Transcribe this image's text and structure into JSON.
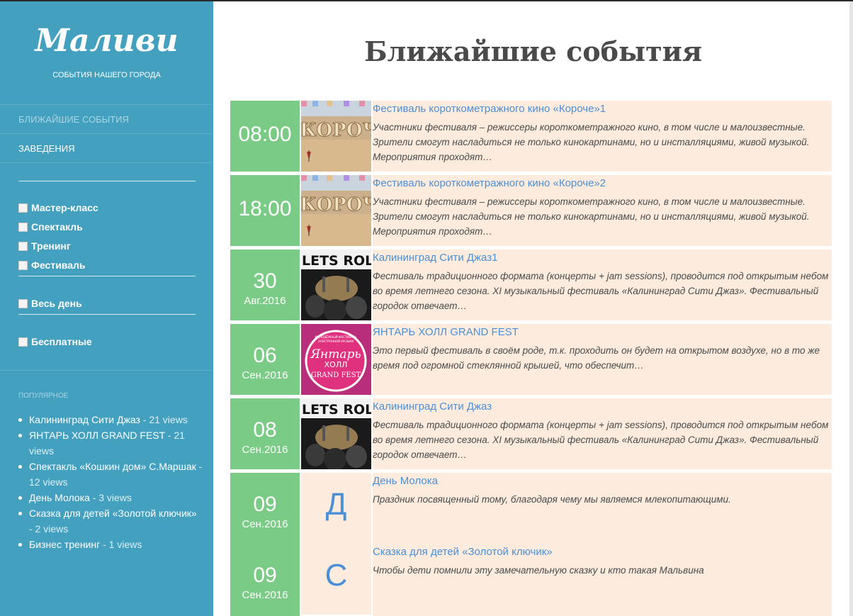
{
  "site": {
    "title": "Маливи",
    "tagline": "СОБЫТИЯ НАШЕГО ГОРОДА"
  },
  "nav": {
    "upcoming": "БЛИЖАЙШИЕ СОБЫТИЯ",
    "venues": "ЗАВЕДЕНИЯ"
  },
  "filters": {
    "categories": [
      "Мастер-класс",
      "Спектакль",
      "Тренинг",
      "Фестиваль"
    ],
    "all_day": "Весь день",
    "free": "Бесплатные"
  },
  "popular": {
    "heading": "ПОПУЛЯРНОЕ",
    "items": [
      {
        "title": "Калининград Сити Джаз",
        "views": " - 21 views"
      },
      {
        "title": "ЯНТАРЬ ХОЛЛ GRAND FEST",
        "views": " - 21 views"
      },
      {
        "title": "Спектакль «Кошкин дом» С.Маршак",
        "views": " - 12 views"
      },
      {
        "title": "День Молока",
        "views": " - 3 views"
      },
      {
        "title": "Сказка для детей «Золотой ключик»",
        "views": " - 2 views"
      },
      {
        "title": "Бизнес тренинг",
        "views": " - 1 views"
      }
    ]
  },
  "main": {
    "page_title": "Ближайшие события",
    "events": [
      {
        "time": "08:00",
        "title": "Фестиваль короткометражного кино «Короче»1",
        "desc": "Участники фестиваля – режиссеры короткометражного кино, в том числе и малоизвестные. Зрители смогут насладиться не только кинокартинами, но и инсталляциями, живой музыкой. Мероприятия проходят…"
      },
      {
        "time": "18:00",
        "title": "Фестиваль короткометражного кино «Короче»2",
        "desc": "Участники фестиваля – режиссеры короткометражного кино, в том числе и малоизвестные. Зрители смогут насладиться не только кинокартинами, но и инсталляциями, живой музыкой. Мероприятия проходят…"
      },
      {
        "day": "30",
        "month": "Авг.2016",
        "title": "Калининград Сити Джаз1",
        "desc": "Фестиваль традиционного формата (концерты + jam sessions), проводится под открытым небом во время летнего сезона. XI музыкальный фестиваль «Калининград Сити Джаз». Фестивальный городок отвечает…"
      },
      {
        "day": "06",
        "month": "Сен.2016",
        "title": "ЯНТАРЬ ХОЛЛ GRAND FEST",
        "desc": "Это первый фестиваль в своём роде, т.к. проходить он будет на открытом воздухе, но в то же время под огромной стеклянной крышей, что обеспечит…"
      },
      {
        "day": "08",
        "month": "Сен.2016",
        "title": "Калининград Сити Джаз",
        "desc": "Фестиваль традиционного формата (концерты + jam sessions), проводится под открытым небом во время летнего сезона. XI музыкальный фестиваль «Калининград Сити Джаз». Фестивальный городок отвечает…"
      },
      {
        "day": "09",
        "month": "Сен.2016",
        "letter": "Д",
        "title": "День Молока",
        "desc": "Праздник посвященный тому, благодаря чему мы являемся млекопитающими."
      },
      {
        "day": "09",
        "month": "Сен.2016",
        "letter": "С",
        "title": "Сказка для детей «Золотой ключик»",
        "desc": "Чтобы дети помнили эту замечательную сказку и кто такая Мальвина"
      }
    ]
  },
  "images": {
    "kino_lettering": "КОРОЧ",
    "jazz_lettering": "LETS ROL",
    "yantar_logo": [
      "МОЛОДЁЖНЫЙ ФЕСТИВАЛЬ",
      "ЭЛЕКТРОННОЙ МУЗЫКИ",
      "Янтарь",
      "ХОЛЛ",
      "GRAND FEST"
    ]
  },
  "colors": {
    "sidebar": "#43a0bf",
    "date_box": "#7acb85",
    "event_bg": "#fdecde",
    "link": "#4b8fd6"
  }
}
